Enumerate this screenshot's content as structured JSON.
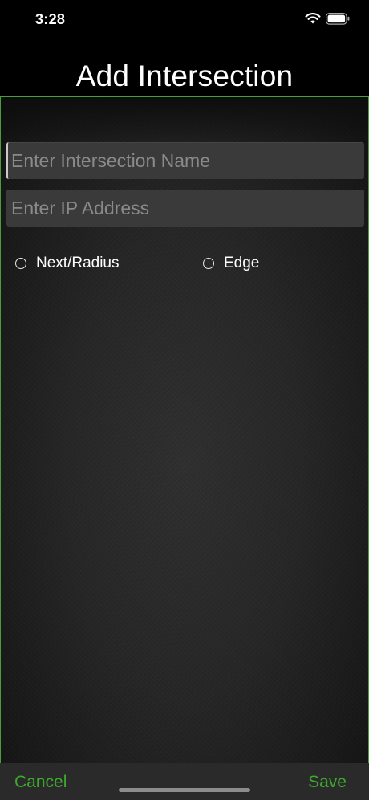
{
  "status_bar": {
    "time": "3:28"
  },
  "page": {
    "title": "Add Intersection"
  },
  "form": {
    "intersection_name": {
      "value": "",
      "placeholder": "Enter Intersection Name"
    },
    "ip_address": {
      "value": "",
      "placeholder": "Enter IP Address"
    },
    "radio_options": [
      {
        "label": "Next/Radius",
        "selected": false
      },
      {
        "label": "Edge",
        "selected": false
      }
    ]
  },
  "toolbar": {
    "cancel_label": "Cancel",
    "save_label": "Save"
  },
  "colors": {
    "accent": "#3fa82f",
    "border": "#4a9e3a",
    "field_background": "#3a3a3a",
    "toolbar_background": "#2a2a2a"
  },
  "icons": [
    "wifi-icon",
    "battery-icon",
    "radio-circle-icon"
  ]
}
